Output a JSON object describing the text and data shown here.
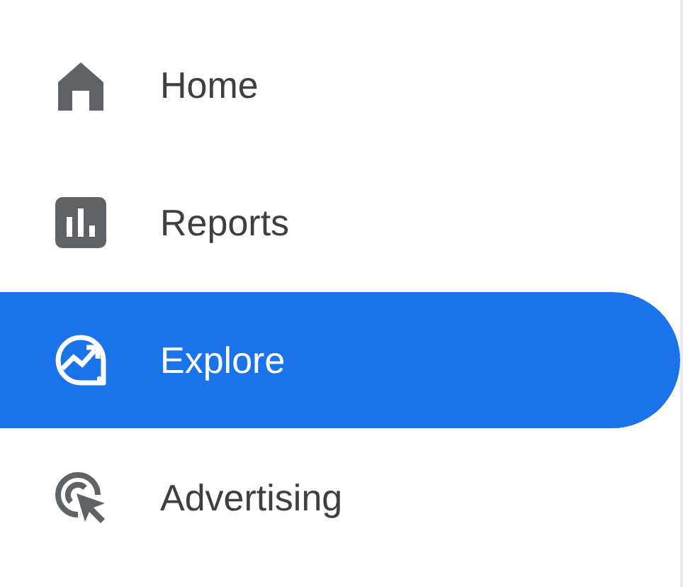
{
  "nav": {
    "items": [
      {
        "kind": "home",
        "label": "Home",
        "selected": false
      },
      {
        "kind": "reports",
        "label": "Reports",
        "selected": false
      },
      {
        "kind": "explore",
        "label": "Explore",
        "selected": true
      },
      {
        "kind": "advertising",
        "label": "Advertising",
        "selected": false
      }
    ]
  }
}
